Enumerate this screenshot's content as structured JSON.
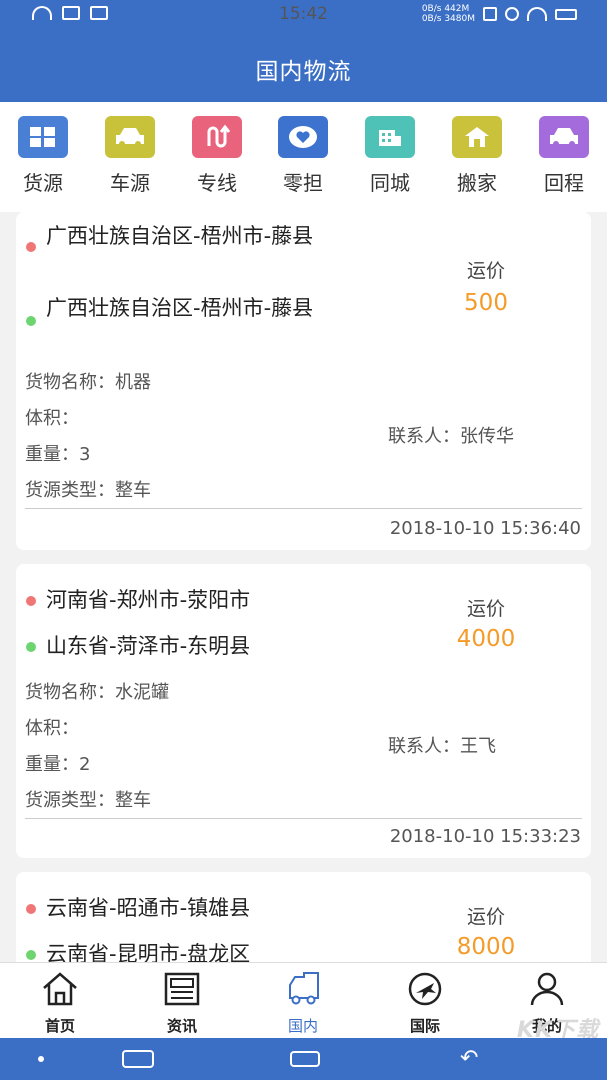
{
  "status_bar": {
    "time": "15:42",
    "net_speed_top": "0B/s",
    "net_speed_bottom": "0B/s",
    "mem_top": "442M",
    "mem_bottom": "3480M"
  },
  "header": {
    "title": "国内物流"
  },
  "categories": [
    {
      "label": "货源",
      "icon": "boxes-icon",
      "color": "#4a7fd6"
    },
    {
      "label": "车源",
      "icon": "car-icon",
      "color": "#c7c23a"
    },
    {
      "label": "专线",
      "icon": "route-icon",
      "color": "#e8637b"
    },
    {
      "label": "零担",
      "icon": "heart-box-icon",
      "color": "#3d73cf"
    },
    {
      "label": "同城",
      "icon": "city-icon",
      "color": "#4fc2b8"
    },
    {
      "label": "搬家",
      "icon": "moving-icon",
      "color": "#c9c23a"
    },
    {
      "label": "回程",
      "icon": "return-car-icon",
      "color": "#a36bdc"
    }
  ],
  "labels": {
    "price": "运价",
    "cargo_name": "货物名称：",
    "volume": "体积：",
    "weight": "重量：",
    "cargo_type": "货源类型：",
    "contact": "联系人："
  },
  "listings": [
    {
      "from": "广西壮族自治区-梧州市-藤县",
      "to": "广西壮族自治区-梧州市-藤县",
      "price": "500",
      "cargo_name": "机器",
      "volume": "",
      "weight": "3",
      "cargo_type": "整车",
      "contact": "张传华",
      "time": "2018-10-10 15:36:40"
    },
    {
      "from": "河南省-郑州市-荥阳市",
      "to": "山东省-菏泽市-东明县",
      "price": "4000",
      "cargo_name": "水泥罐",
      "volume": "",
      "weight": "2",
      "cargo_type": "整车",
      "contact": "王飞",
      "time": "2018-10-10 15:33:23"
    },
    {
      "from": "云南省-昭通市-镇雄县",
      "to": "云南省-昆明市-盘龙区",
      "price": "8000"
    }
  ],
  "tabs": [
    {
      "label": "首页",
      "icon": "home-icon",
      "active": false
    },
    {
      "label": "资讯",
      "icon": "news-icon",
      "active": false
    },
    {
      "label": "国内",
      "icon": "truck-icon",
      "active": true
    },
    {
      "label": "国际",
      "icon": "plane-icon",
      "active": false
    },
    {
      "label": "我的",
      "icon": "user-icon",
      "active": false
    }
  ],
  "colors": {
    "primary": "#3b6fc6",
    "price": "#f49b2a",
    "from_dot": "#f07676",
    "to_dot": "#6ed46f"
  },
  "watermark": "KK下载"
}
